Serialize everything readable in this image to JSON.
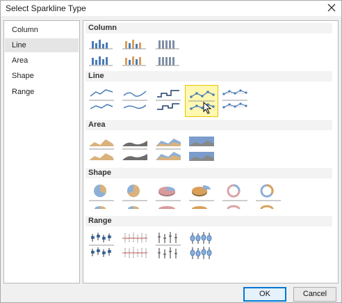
{
  "dialog": {
    "title": "Select Sparkline Type"
  },
  "nav": {
    "items": [
      {
        "label": "Column"
      },
      {
        "label": "Line"
      },
      {
        "label": "Area"
      },
      {
        "label": "Shape"
      },
      {
        "label": "Range"
      }
    ],
    "selected": "Line"
  },
  "gallery": {
    "sections": [
      {
        "title": "Column"
      },
      {
        "title": "Line"
      },
      {
        "title": "Area"
      },
      {
        "title": "Shape"
      },
      {
        "title": "Range"
      }
    ]
  },
  "buttons": {
    "ok": "OK",
    "cancel": "Cancel"
  },
  "colors": {
    "blue": "#4a7bb7",
    "orange": "#d9a05b",
    "gray": "#7f7f7f",
    "selection": "#fff8b0"
  }
}
